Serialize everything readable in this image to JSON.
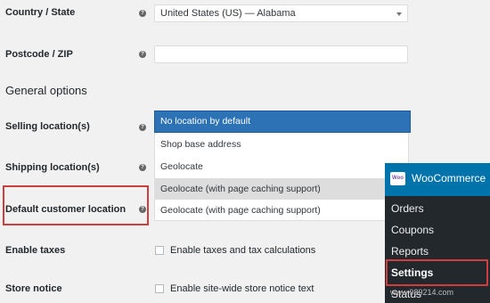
{
  "fields": {
    "country_label": "Country / State",
    "country_value": "United States (US) — Alabama",
    "postcode_label": "Postcode / ZIP",
    "postcode_value": ""
  },
  "general": {
    "section_title": "General options",
    "selling_label": "Selling location(s)",
    "shipping_label": "Shipping location(s)",
    "default_location_label": "Default customer location",
    "taxes_label": "Enable taxes",
    "taxes_checkbox_label": "Enable taxes and tax calculations",
    "store_notice_label": "Store notice",
    "store_notice_checkbox_label": "Enable site-wide store notice text"
  },
  "dropdown": {
    "options": [
      "No location by default",
      "Shop base address",
      "Geolocate",
      "Geolocate (with page caching support)",
      "Geolocate (with page caching support)"
    ],
    "selected_index": 0,
    "hovered_index": 3
  },
  "help_icon": "?",
  "admin_menu": {
    "logo_text": "Woo",
    "title": "WooCommerce",
    "items": [
      "Orders",
      "Coupons",
      "Reports",
      "Settings",
      "Status"
    ],
    "active_item": "Settings"
  },
  "watermark": "www.989214.com",
  "colors": {
    "highlight_red": "#cf3e3e",
    "selected_blue": "#2e72b6",
    "admin_header_blue": "#0073aa",
    "admin_menu_dark": "#23282d"
  }
}
